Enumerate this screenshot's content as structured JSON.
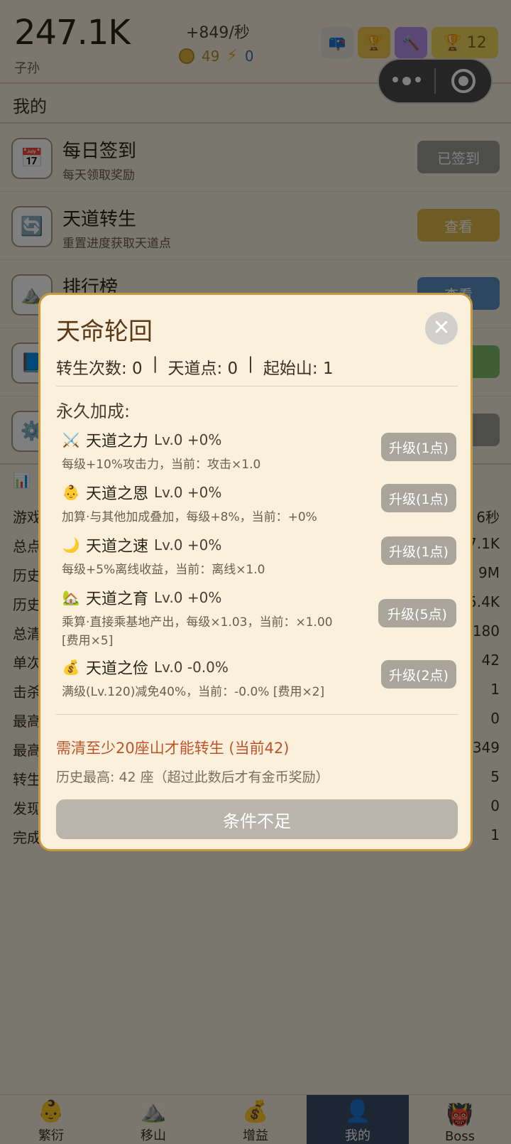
{
  "header": {
    "count": "247.1K",
    "count_label": "子孙",
    "rate": "+849/秒",
    "coins": "49",
    "energy": "0",
    "trophy": "12"
  },
  "section": {
    "title": "我的"
  },
  "menu": [
    {
      "title": "每日签到",
      "sub": "每天领取奖励",
      "button": "已签到",
      "btn_color": "#9b9a96",
      "icon": "calendar-icon"
    },
    {
      "title": "天道转生",
      "sub": "重置进度获取天道点",
      "button": "查看",
      "btn_color": "#e1bb4a",
      "icon": "refresh-icon"
    },
    {
      "title": "排行榜",
      "sub": "",
      "button": "查看",
      "btn_color": "#5d8ec2",
      "icon": "mountain-icon"
    },
    {
      "title": "",
      "sub": "",
      "button": "",
      "btn_color": "#7cbf6a",
      "icon": "book-icon"
    },
    {
      "title": "",
      "sub": "",
      "button": "",
      "btn_color": "#9b9a96",
      "icon": "gear-icon"
    }
  ],
  "stats": [
    {
      "k": "游戏",
      "v": "6秒"
    },
    {
      "k": "总点",
      "v": "7.1K"
    },
    {
      "k": "历史",
      "v": "9M"
    },
    {
      "k": "历史",
      "v": "5.4K"
    },
    {
      "k": "总清",
      "v": "180"
    },
    {
      "k": "单次",
      "v": "42"
    },
    {
      "k": "击杀",
      "v": "1"
    },
    {
      "k": "最高",
      "v": "0"
    },
    {
      "k": "最高",
      "v": "349"
    },
    {
      "k": "转生",
      "v": "5"
    },
    {
      "k": "发现",
      "v": "0"
    },
    {
      "k": "完成",
      "v": "1"
    }
  ],
  "nav": [
    {
      "label": "繁衍",
      "icon": "baby-icon"
    },
    {
      "label": "移山",
      "icon": "mountain-icon"
    },
    {
      "label": "增益",
      "icon": "money-bag-icon"
    },
    {
      "label": "我的",
      "icon": "person-icon",
      "active": true
    },
    {
      "label": "Boss",
      "icon": "demon-icon"
    }
  ],
  "modal": {
    "title": "天命轮回",
    "rebirth_count": "转生次数: 0",
    "dao_points": "天道点: 0",
    "start_mountain": "起始山: 1",
    "sep": "|",
    "perm_title": "永久加成:",
    "perks": [
      {
        "icon": "⚔️",
        "name": "天道之力",
        "lv": "Lv.0 +0%",
        "desc": "每级+10%攻击力，当前：攻击×1.0",
        "btn": "升级(1点)"
      },
      {
        "icon": "👶",
        "name": "天道之恩",
        "lv": "Lv.0 +0%",
        "desc": "加算·与其他加成叠加，每级+8%，当前：+0%",
        "btn": "升级(1点)"
      },
      {
        "icon": "🌙",
        "name": "天道之速",
        "lv": "Lv.0 +0%",
        "desc": "每级+5%离线收益，当前：离线×1.0",
        "btn": "升级(1点)"
      },
      {
        "icon": "🏡",
        "name": "天道之育",
        "lv": "Lv.0 +0%",
        "desc": "乘算·直接乘基地产出，每级×1.03，当前：×1.00 [费用×5]",
        "btn": "升级(5点)"
      },
      {
        "icon": "💰",
        "name": "天道之俭",
        "lv": "Lv.0 -0.0%",
        "desc": "满级(Lv.120)减免40%，当前：-0.0% [费用×2]",
        "btn": "升级(2点)"
      }
    ],
    "warning": "需清至少20座山才能转生 (当前42)",
    "history": "历史最高: 42 座（超过此数后才有金币奖励）",
    "submit": "条件不足"
  }
}
